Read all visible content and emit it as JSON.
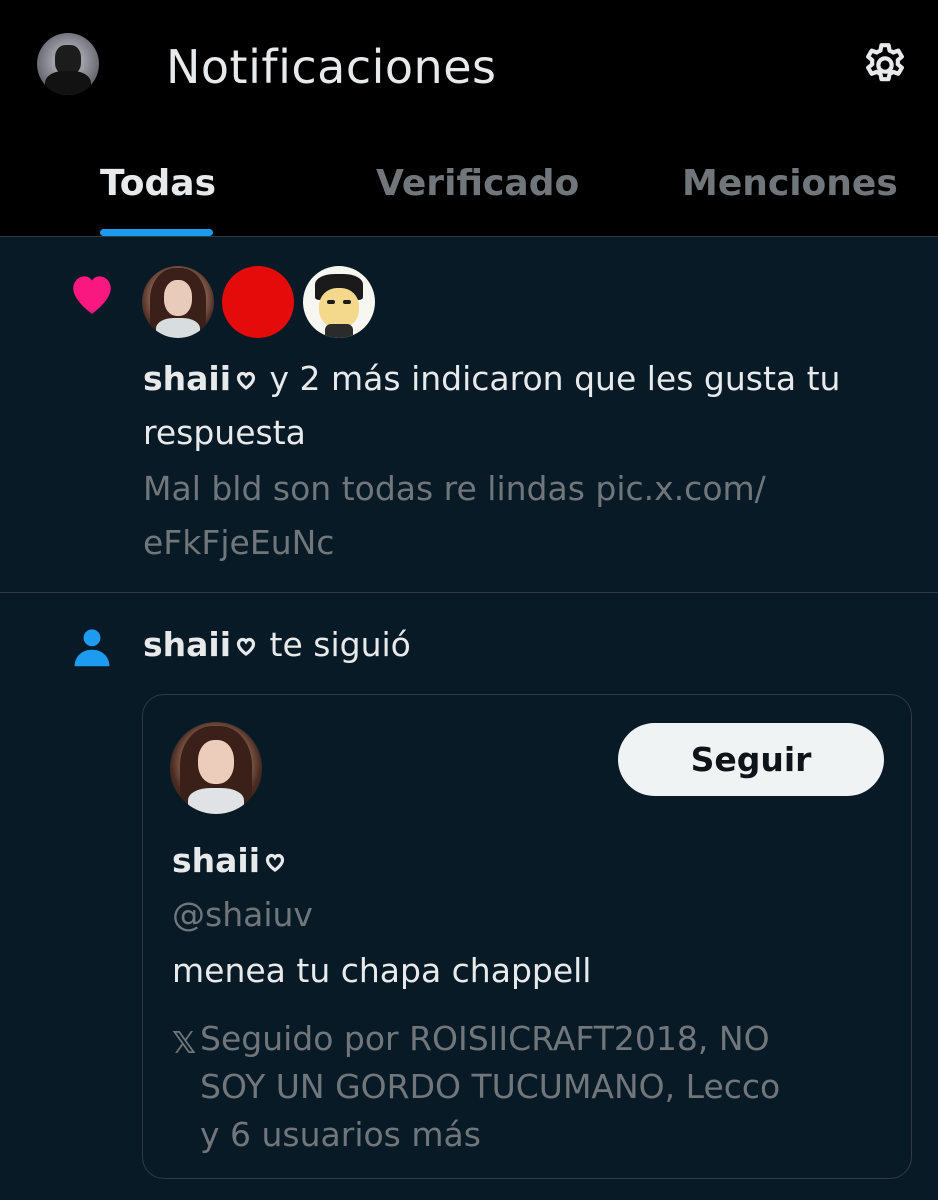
{
  "header": {
    "title": "Notificaciones",
    "settings_icon": "gear-icon"
  },
  "tabs": [
    {
      "label": "Todas",
      "active": true
    },
    {
      "label": "Verificado",
      "active": false
    },
    {
      "label": "Menciones",
      "active": false
    }
  ],
  "colors": {
    "accent": "#1d9bf0",
    "like": "#f91880",
    "background": "#081a26",
    "muted": "#71767b"
  },
  "notifications": [
    {
      "type": "like",
      "icon": "heart-icon",
      "user": "shaii",
      "text": "y 2 más indicaron que les gusta tu",
      "text_line2": "respuesta",
      "preview_line1": "Mal bld son todas re lindas pic.x.com/",
      "preview_line2": "eFkFjeEuNc"
    },
    {
      "type": "follow",
      "icon": "person-icon",
      "user": "shaii",
      "text": "te siguió",
      "card": {
        "name": "shaii",
        "handle": "@shaiuv",
        "bio": "menea tu chapa chappell",
        "follow_label": "Seguir",
        "x_mark": "𝕏",
        "followed_by_line1": "Seguido por ROISIICRAFT2018, NO",
        "followed_by_line2": "SOY UN GORDO TUCUMANO, Lecco",
        "followed_by_line3": "y 6 usuarios más"
      }
    }
  ]
}
